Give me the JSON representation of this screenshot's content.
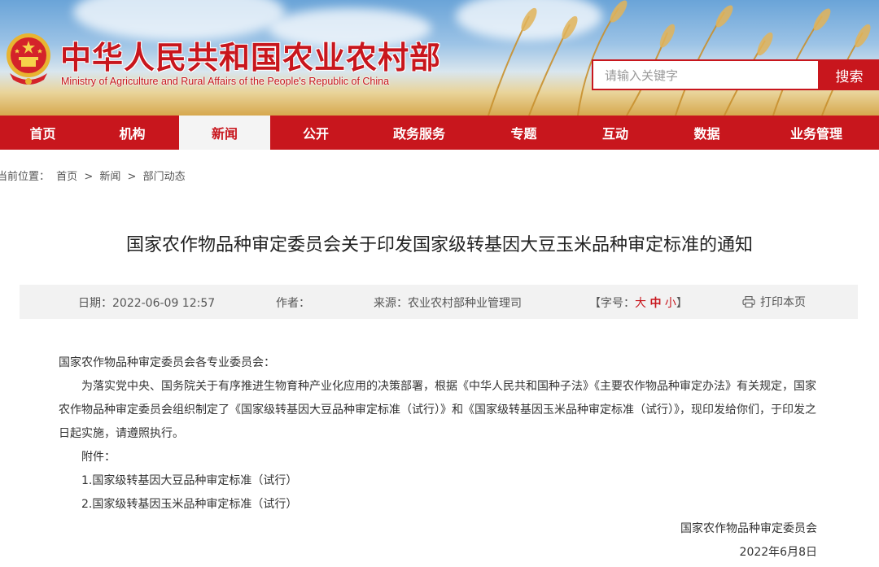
{
  "header": {
    "title_cn": "中华人民共和国农业农村部",
    "title_en": "Ministry of Agriculture and Rural Affairs of the People's Republic of China",
    "search_placeholder": "请输入关键字",
    "search_button": "搜索",
    "emblem_icon": "national-emblem-icon"
  },
  "nav": {
    "items": [
      "首页",
      "机构",
      "新闻",
      "公开",
      "政务服务",
      "专题",
      "互动",
      "数据",
      "业务管理"
    ],
    "active": "新闻"
  },
  "breadcrumb": {
    "label": "当前位置：",
    "items": [
      "首页",
      "新闻",
      "部门动态"
    ],
    "separator": ">"
  },
  "article": {
    "title": "国家农作物品种审定委员会关于印发国家级转基因大豆玉米品种审定标准的通知",
    "meta": {
      "date_label": "日期：",
      "date": "2022-06-09 12:57",
      "author_label": "作者：",
      "author": "",
      "source_label": "来源：",
      "source": "农业农村部种业管理司",
      "fontsize_open": "【字号：",
      "fontsize_large": "大",
      "fontsize_medium": "中",
      "fontsize_small": "小",
      "fontsize_close": "】",
      "print": "打印本页",
      "print_icon": "printer-icon"
    },
    "salutation": "国家农作物品种审定委员会各专业委员会：",
    "paragraph": "为落实党中央、国务院关于有序推进生物育种产业化应用的决策部署，根据《中华人民共和国种子法》《主要农作物品种审定办法》有关规定，国家农作物品种审定委员会组织制定了《国家级转基因大豆品种审定标准（试行）》和《国家级转基因玉米品种审定标准（试行）》，现印发给你们，于印发之日起实施，请遵照执行。",
    "attachment_label": "附件：",
    "attachments": [
      "1.国家级转基因大豆品种审定标准（试行）",
      "2.国家级转基因玉米品种审定标准（试行）"
    ],
    "signature_org": "国家农作物品种审定委员会",
    "signature_date": "2022年6月8日"
  },
  "colors": {
    "brand_red": "#c8161d",
    "meta_bg": "#f2f2f2"
  }
}
